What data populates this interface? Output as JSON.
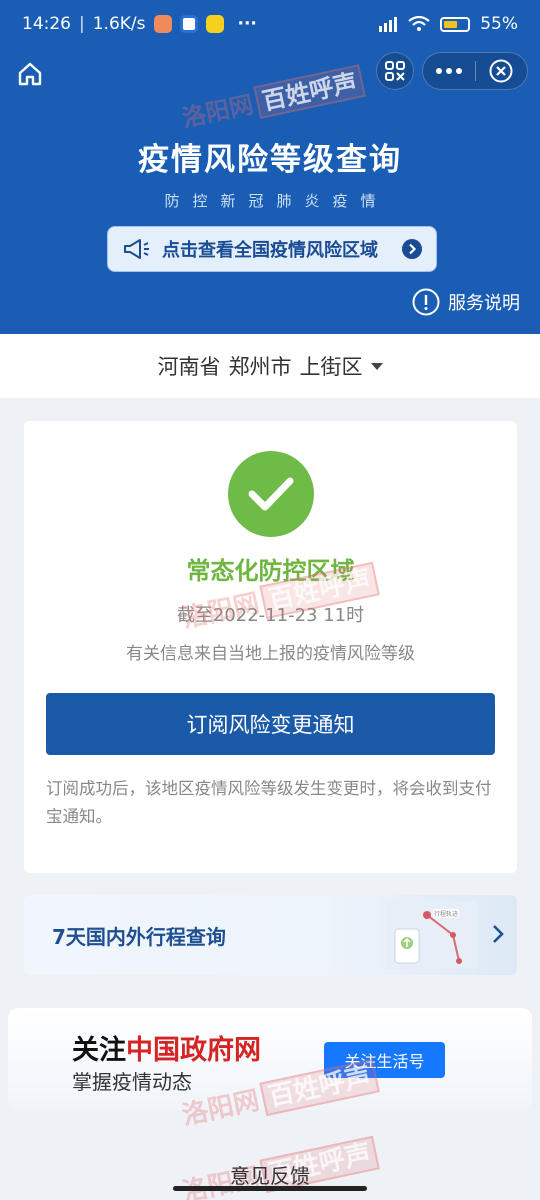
{
  "status_bar": {
    "time": "14:26",
    "speed": "1.6K/s",
    "more": "···",
    "battery": "55%",
    "colors": {
      "accent_battery": "#f3c11b"
    }
  },
  "header": {
    "title": "疫情风险等级查询",
    "subtitle": "防控新冠肺炎疫情",
    "national_button_label": "点击查看全国疫情风险区域",
    "service_note_label": "服务说明",
    "colors": {
      "background": "#1a5db4"
    }
  },
  "region": {
    "province": "河南省",
    "city": "郑州市",
    "district": "上街区"
  },
  "risk_card": {
    "status_label": "常态化防控区域",
    "as_of": "截至2022-11-23 11时",
    "source_note": "有关信息来自当地上报的疫情风险等级",
    "subscribe_button_label": "订阅风险变更通知",
    "subscribe_note": "订阅成功后，该地区疫情风险等级发生变更时，将会收到支付宝通知。",
    "colors": {
      "status_green": "#6fb640",
      "button_blue": "#1a5aa8"
    }
  },
  "trip_card": {
    "label": "7天国内外行程查询",
    "map_tag": "行程轨迹"
  },
  "ad_card": {
    "line1_prefix": "关注",
    "line1_highlight": "中国政府网",
    "line2": "掌握疫情动态",
    "follow_button_label": "关注生活号",
    "colors": {
      "highlight_red": "#d42424",
      "follow_blue": "#1677ff"
    }
  },
  "footer": {
    "feedback_label": "意见反馈"
  },
  "watermark": {
    "script": "洛阳网",
    "boxed": "百姓呼声"
  }
}
